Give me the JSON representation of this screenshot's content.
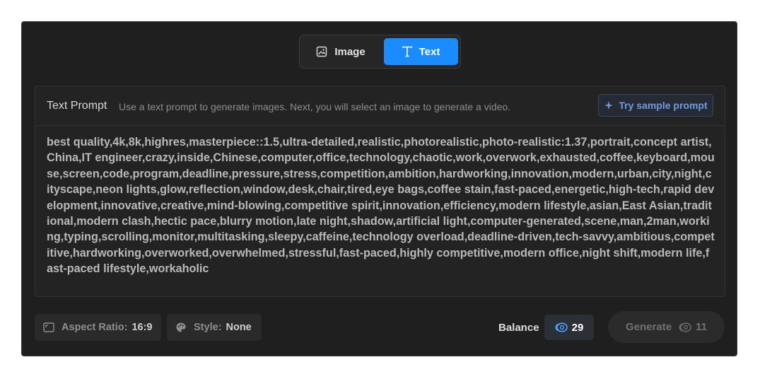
{
  "mode_toggle": {
    "image_label": "Image",
    "text_label": "Text",
    "active": "Text"
  },
  "prompt": {
    "title": "Text Prompt",
    "hint": "Use a text prompt to generate images. Next, you will select an image to generate a video.",
    "sample_button_label": "Try sample prompt",
    "text": "best quality,4k,8k,highres,masterpiece::1.5,ultra-detailed,realistic,photorealistic,photo-realistic:1.37,portrait,concept artist,China,IT engineer,crazy,inside,Chinese,computer,office,technology,chaotic,work,overwork,exhausted,coffee,keyboard,mouse,screen,code,program,deadline,pressure,stress,competition,ambition,hardworking,innovation,modern,urban,city,night,cityscape,neon lights,glow,reflection,window,desk,chair,tired,eye bags,coffee stain,fast-paced,energetic,high-tech,rapid development,innovative,creative,mind-blowing,competitive spirit,innovation,efficiency,modern lifestyle,asian,East Asian,traditional,modern clash,hectic pace,blurry motion,late night,shadow,artificial light,computer-generated,scene,man,2man,working,typing,scrolling,monitor,multitasking,sleepy,caffeine,technology overload,deadline-driven,tech-savvy,ambitious,competitive,hardworking,overworked,overwhelmed,stressful,fast-paced,highly competitive,modern office,night shift,modern life,fast-paced lifestyle,workaholic"
  },
  "options": {
    "aspect_ratio_label": "Aspect Ratio:",
    "aspect_ratio_value": "16:9",
    "style_label": "Style:",
    "style_value": "None"
  },
  "balance": {
    "label": "Balance",
    "value": "29"
  },
  "generate": {
    "label": "Generate",
    "cost": "11"
  },
  "colors": {
    "accent": "#1b8cff",
    "panel": "#1f1f1f",
    "sample_text": "#6f9ce6"
  }
}
